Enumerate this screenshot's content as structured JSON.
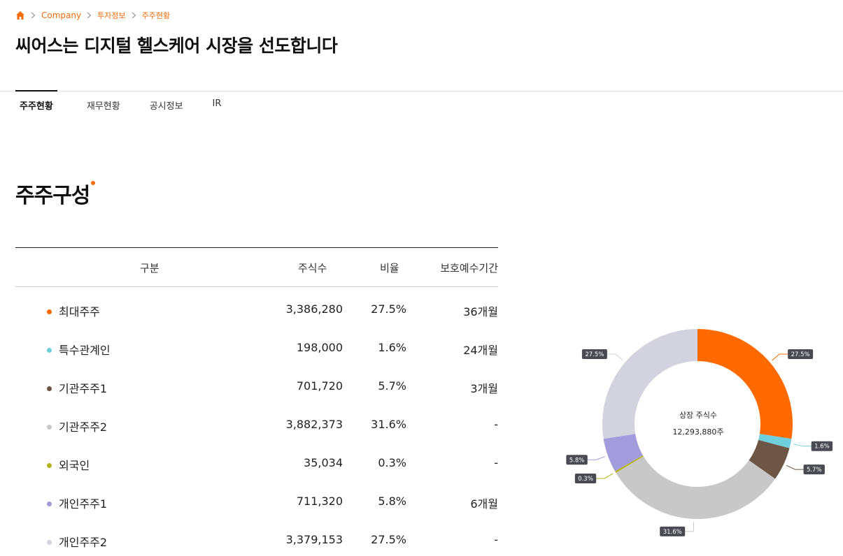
{
  "breadcrumb": {
    "items": [
      "Company",
      "투자정보",
      "주주현황"
    ]
  },
  "page_title": "씨어스는 디지털 헬스케어 시장을 선도합니다",
  "tabs": [
    {
      "label": "주주현황",
      "active": true
    },
    {
      "label": "재무현황",
      "active": false
    },
    {
      "label": "공시정보",
      "active": false
    },
    {
      "label": "IR",
      "active": false
    }
  ],
  "section_title": "주주구성",
  "table": {
    "headers": {
      "category": "구분",
      "shares": "주식수",
      "ratio": "비율",
      "lockup": "보호예수기간"
    },
    "rows": [
      {
        "name": "최대주주",
        "shares": "3,386,280",
        "ratio": "27.5%",
        "lockup": "36개월",
        "color": "#ff6a00"
      },
      {
        "name": "특수관계인",
        "shares": "198,000",
        "ratio": "1.6%",
        "lockup": "24개월",
        "color": "#6fcfdc"
      },
      {
        "name": "기관주주1",
        "shares": "701,720",
        "ratio": "5.7%",
        "lockup": "3개월",
        "color": "#6e5646"
      },
      {
        "name": "기관주주2",
        "shares": "3,882,373",
        "ratio": "31.6%",
        "lockup": "-",
        "color": "#c8c8c8"
      },
      {
        "name": "외국인",
        "shares": "35,034",
        "ratio": "0.3%",
        "lockup": "-",
        "color": "#b3b51a"
      },
      {
        "name": "개인주주1",
        "shares": "711,320",
        "ratio": "5.8%",
        "lockup": "6개월",
        "color": "#a29bdc"
      },
      {
        "name": "개인주주2",
        "shares": "3,379,153",
        "ratio": "27.5%",
        "lockup": "-",
        "color": "#d3d3e0"
      }
    ]
  },
  "chart_center": {
    "label": "상장 주식수",
    "total": "12,293,880주"
  },
  "chart_data": {
    "type": "pie",
    "donut": true,
    "categories": [
      "최대주주",
      "특수관계인",
      "기관주주1",
      "기관주주2",
      "외국인",
      "개인주주1",
      "개인주주2"
    ],
    "values": [
      27.5,
      1.6,
      5.7,
      31.6,
      0.3,
      5.8,
      27.5
    ],
    "data_labels": [
      "27.5%",
      "1.6%",
      "5.7%",
      "31.6%",
      "0.3%",
      "5.8%",
      "27.5%"
    ],
    "colors": [
      "#ff6a00",
      "#6fcfdc",
      "#6e5646",
      "#c8c8c8",
      "#b3b51a",
      "#a29bdc",
      "#d3d3e0"
    ],
    "legend": "none"
  },
  "colors": {
    "accent": "#f26d0d"
  }
}
